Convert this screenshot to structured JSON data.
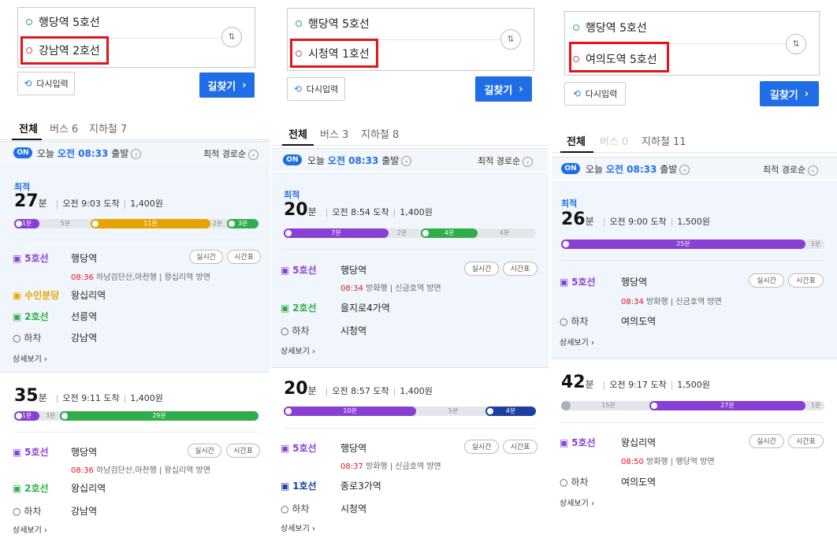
{
  "common": {
    "reset_label": "다시입력",
    "search_label": "길찾기",
    "tab_all": "전체",
    "on_badge": "ON",
    "depart_prefix": "오늘",
    "depart_time": "오전 08:33",
    "depart_suffix": "출발",
    "sort_label": "최적 경로순",
    "best_label": "최적",
    "realtime_label": "실시간",
    "timetable_label": "시간표",
    "more_label": "상세보기",
    "minute_unit": "분",
    "swap_icon": "swap-vertical-icon",
    "colors": {
      "accent": "#1f6ee6",
      "line5": "#8a3fd4",
      "line2": "#2fad4a",
      "line1": "#1d3fa0",
      "suin": "#e6a400",
      "highlight": "#e2151a"
    }
  },
  "panels": [
    {
      "start": "행당역 5호선",
      "end": "강남역 2호선",
      "tab_bus": "버스 6",
      "tab_subway": "지하철 7",
      "routes": [
        {
          "minutes": "27",
          "arrive": "오전 9:03 도착",
          "fare": "1,400원",
          "segments": [
            {
              "label": "1분",
              "kind": "line5"
            },
            {
              "label": "5분",
              "kind": "gap"
            },
            {
              "label": "11분",
              "kind": "suin"
            },
            {
              "label": "2분",
              "kind": "gap"
            },
            {
              "label": "3분",
              "kind": "line2"
            }
          ],
          "steps": [
            {
              "line": "5호선",
              "station": "행당역",
              "detail_time": "08:36",
              "detail_dir": "하남검단산,마천행",
              "detail_platform": "왕십리역 방면",
              "kind": "line5"
            },
            {
              "line": "수인분당",
              "station": "왕십리역",
              "kind": "suin"
            },
            {
              "line": "2호선",
              "station": "선릉역",
              "kind": "line2"
            },
            {
              "line": "하차",
              "station": "강남역",
              "kind": "exit"
            }
          ]
        },
        {
          "minutes": "35",
          "arrive": "오전 9:11 도착",
          "fare": "1,400원",
          "segments": [
            {
              "label": "1분",
              "kind": "line5"
            },
            {
              "label": "3분",
              "kind": "gap"
            },
            {
              "label": "29분",
              "kind": "line2"
            }
          ],
          "steps": [
            {
              "line": "5호선",
              "station": "행당역",
              "detail_time": "08:36",
              "detail_dir": "하남검단산,마천행",
              "detail_platform": "왕십리역 방면",
              "kind": "line5"
            },
            {
              "line": "2호선",
              "station": "왕십리역",
              "kind": "line2"
            },
            {
              "line": "하차",
              "station": "강남역",
              "kind": "exit"
            }
          ]
        }
      ]
    },
    {
      "start": "행당역 5호선",
      "end": "시청역 1호선",
      "tab_bus": "버스 3",
      "tab_subway": "지하철 8",
      "routes": [
        {
          "minutes": "20",
          "arrive": "오전 8:54 도착",
          "fare": "1,400원",
          "segments": [
            {
              "label": "7분",
              "kind": "line5"
            },
            {
              "label": "2분",
              "kind": "gap"
            },
            {
              "label": "4분",
              "kind": "line2"
            },
            {
              "label": "4분",
              "kind": "gap"
            }
          ],
          "steps": [
            {
              "line": "5호선",
              "station": "행당역",
              "detail_time": "08:34",
              "detail_dir": "방화행",
              "detail_platform": "신금호역 방면",
              "kind": "line5"
            },
            {
              "line": "2호선",
              "station": "을지로4가역",
              "kind": "line2"
            },
            {
              "line": "하차",
              "station": "시청역",
              "kind": "exit"
            }
          ]
        },
        {
          "minutes": "20",
          "arrive": "오전 8:57 도착",
          "fare": "1,400원",
          "segments": [
            {
              "label": "10분",
              "kind": "line5"
            },
            {
              "label": "5분",
              "kind": "gap"
            },
            {
              "label": "4분",
              "kind": "line1"
            }
          ],
          "steps": [
            {
              "line": "5호선",
              "station": "행당역",
              "detail_time": "08:37",
              "detail_dir": "방화행",
              "detail_platform": "신금호역 방면",
              "kind": "line5"
            },
            {
              "line": "1호선",
              "station": "종로3가역",
              "kind": "line1"
            },
            {
              "line": "하차",
              "station": "시청역",
              "kind": "exit"
            }
          ]
        }
      ]
    },
    {
      "start": "행당역 5호선",
      "end": "여의도역 5호선",
      "tab_bus": "버스 0",
      "tab_subway": "지하철 11",
      "routes": [
        {
          "minutes": "26",
          "arrive": "오전 9:00 도착",
          "fare": "1,500원",
          "segments": [
            {
              "label": "25분",
              "kind": "line5"
            },
            {
              "label": "1분",
              "kind": "gap"
            }
          ],
          "steps": [
            {
              "line": "5호선",
              "station": "행당역",
              "detail_time": "08:34",
              "detail_dir": "방화행",
              "detail_platform": "신금호역 방면",
              "kind": "line5"
            },
            {
              "line": "하차",
              "station": "여의도역",
              "kind": "exit"
            }
          ]
        },
        {
          "minutes": "42",
          "arrive": "오전 9:17 도착",
          "fare": "1,500원",
          "segments": [
            {
              "label": "15분",
              "kind": "walk"
            },
            {
              "label": "27분",
              "kind": "line5"
            },
            {
              "label": "1분",
              "kind": "gap"
            }
          ],
          "steps": [
            {
              "line": "5호선",
              "station": "왕십리역",
              "detail_time": "08:50",
              "detail_dir": "방화행",
              "detail_platform": "행당역 방면",
              "kind": "line5"
            },
            {
              "line": "하차",
              "station": "여의도역",
              "kind": "exit"
            }
          ]
        }
      ]
    }
  ]
}
